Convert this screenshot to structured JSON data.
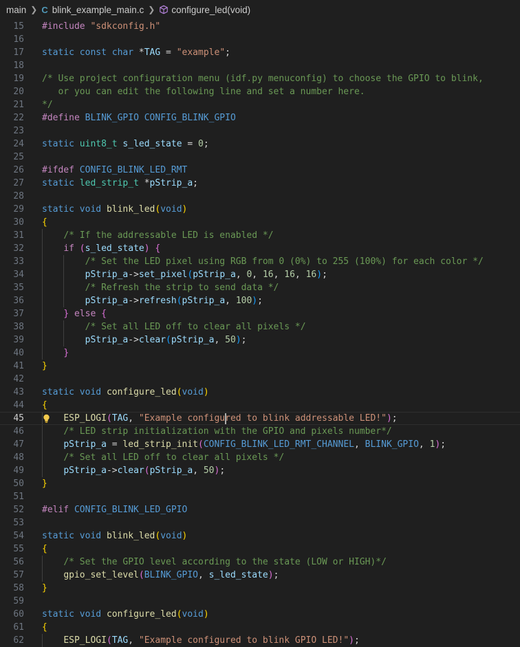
{
  "breadcrumb": {
    "folder": "main",
    "file_icon_letter": "C",
    "file": "blink_example_main.c",
    "symbol": "configure_led(void)"
  },
  "editor": {
    "current_line": 45,
    "lines": [
      {
        "n": "15",
        "t": [
          [
            "pp",
            "#include "
          ],
          [
            "str",
            "\"sdkconfig.h\""
          ]
        ]
      },
      {
        "n": "16",
        "t": []
      },
      {
        "n": "17",
        "t": [
          [
            "kw",
            "static "
          ],
          [
            "kw",
            "const "
          ],
          [
            "kw",
            "char "
          ],
          [
            "pl",
            "*"
          ],
          [
            "var",
            "TAG"
          ],
          [
            "pl",
            " = "
          ],
          [
            "str",
            "\"example\""
          ],
          [
            "pl",
            ";"
          ]
        ]
      },
      {
        "n": "18",
        "t": []
      },
      {
        "n": "19",
        "t": [
          [
            "cmt",
            "/* Use project configuration menu (idf.py menuconfig) to choose the GPIO to blink,"
          ]
        ]
      },
      {
        "n": "20",
        "t": [
          [
            "cmt",
            "   or you can edit the following line and set a number here."
          ]
        ]
      },
      {
        "n": "21",
        "t": [
          [
            "cmt",
            "*/"
          ]
        ]
      },
      {
        "n": "22",
        "t": [
          [
            "pp",
            "#define "
          ],
          [
            "mac",
            "BLINK_GPIO "
          ],
          [
            "mac",
            "CONFIG_BLINK_GPIO"
          ]
        ]
      },
      {
        "n": "23",
        "t": []
      },
      {
        "n": "24",
        "t": [
          [
            "kw",
            "static "
          ],
          [
            "ty",
            "uint8_t "
          ],
          [
            "var",
            "s_led_state"
          ],
          [
            "pl",
            " = "
          ],
          [
            "num",
            "0"
          ],
          [
            "pl",
            ";"
          ]
        ]
      },
      {
        "n": "25",
        "t": []
      },
      {
        "n": "26",
        "t": [
          [
            "pp",
            "#ifdef "
          ],
          [
            "mac",
            "CONFIG_BLINK_LED_RMT"
          ]
        ]
      },
      {
        "n": "27",
        "t": [
          [
            "kw",
            "static "
          ],
          [
            "ty",
            "led_strip_t "
          ],
          [
            "pl",
            "*"
          ],
          [
            "var",
            "pStrip_a"
          ],
          [
            "pl",
            ";"
          ]
        ]
      },
      {
        "n": "28",
        "t": []
      },
      {
        "n": "29",
        "t": [
          [
            "kw",
            "static "
          ],
          [
            "kw",
            "void "
          ],
          [
            "fn",
            "blink_led"
          ],
          [
            "br1",
            "("
          ],
          [
            "kw",
            "void"
          ],
          [
            "br1",
            ")"
          ]
        ]
      },
      {
        "n": "30",
        "t": [
          [
            "br1",
            "{"
          ]
        ]
      },
      {
        "n": "31",
        "t": [
          [
            "pl",
            "    "
          ],
          [
            "cmt",
            "/* If the addressable LED is enabled */"
          ]
        ]
      },
      {
        "n": "32",
        "t": [
          [
            "pl",
            "    "
          ],
          [
            "pp",
            "if "
          ],
          [
            "br2",
            "("
          ],
          [
            "var",
            "s_led_state"
          ],
          [
            "br2",
            ")"
          ],
          [
            "pl",
            " "
          ],
          [
            "br2",
            "{"
          ]
        ]
      },
      {
        "n": "33",
        "t": [
          [
            "pl",
            "        "
          ],
          [
            "cmt",
            "/* Set the LED pixel using RGB from 0 (0%) to 255 (100%) for each color */"
          ]
        ]
      },
      {
        "n": "34",
        "t": [
          [
            "pl",
            "        "
          ],
          [
            "var",
            "pStrip_a"
          ],
          [
            "pl",
            "->"
          ],
          [
            "var",
            "set_pixel"
          ],
          [
            "br3",
            "("
          ],
          [
            "var",
            "pStrip_a"
          ],
          [
            "pl",
            ", "
          ],
          [
            "num",
            "0"
          ],
          [
            "pl",
            ", "
          ],
          [
            "num",
            "16"
          ],
          [
            "pl",
            ", "
          ],
          [
            "num",
            "16"
          ],
          [
            "pl",
            ", "
          ],
          [
            "num",
            "16"
          ],
          [
            "br3",
            ")"
          ],
          [
            "pl",
            ";"
          ]
        ]
      },
      {
        "n": "35",
        "t": [
          [
            "pl",
            "        "
          ],
          [
            "cmt",
            "/* Refresh the strip to send data */"
          ]
        ]
      },
      {
        "n": "36",
        "t": [
          [
            "pl",
            "        "
          ],
          [
            "var",
            "pStrip_a"
          ],
          [
            "pl",
            "->"
          ],
          [
            "var",
            "refresh"
          ],
          [
            "br3",
            "("
          ],
          [
            "var",
            "pStrip_a"
          ],
          [
            "pl",
            ", "
          ],
          [
            "num",
            "100"
          ],
          [
            "br3",
            ")"
          ],
          [
            "pl",
            ";"
          ]
        ]
      },
      {
        "n": "37",
        "t": [
          [
            "pl",
            "    "
          ],
          [
            "br2",
            "}"
          ],
          [
            "pl",
            " "
          ],
          [
            "pp",
            "else "
          ],
          [
            "br2",
            "{"
          ]
        ]
      },
      {
        "n": "38",
        "t": [
          [
            "pl",
            "        "
          ],
          [
            "cmt",
            "/* Set all LED off to clear all pixels */"
          ]
        ]
      },
      {
        "n": "39",
        "t": [
          [
            "pl",
            "        "
          ],
          [
            "var",
            "pStrip_a"
          ],
          [
            "pl",
            "->"
          ],
          [
            "var",
            "clear"
          ],
          [
            "br3",
            "("
          ],
          [
            "var",
            "pStrip_a"
          ],
          [
            "pl",
            ", "
          ],
          [
            "num",
            "50"
          ],
          [
            "br3",
            ")"
          ],
          [
            "pl",
            ";"
          ]
        ]
      },
      {
        "n": "40",
        "t": [
          [
            "pl",
            "    "
          ],
          [
            "br2",
            "}"
          ]
        ]
      },
      {
        "n": "41",
        "t": [
          [
            "br1",
            "}"
          ]
        ]
      },
      {
        "n": "42",
        "t": []
      },
      {
        "n": "43",
        "t": [
          [
            "kw",
            "static "
          ],
          [
            "kw",
            "void "
          ],
          [
            "fn",
            "configure_led"
          ],
          [
            "br1",
            "("
          ],
          [
            "kw",
            "void"
          ],
          [
            "br1",
            ")"
          ]
        ]
      },
      {
        "n": "44",
        "t": [
          [
            "br1",
            "{"
          ]
        ]
      },
      {
        "n": "45",
        "t": [
          [
            "pl",
            "    "
          ],
          [
            "fn",
            "ESP_LOGI"
          ],
          [
            "br2",
            "("
          ],
          [
            "var",
            "TAG"
          ],
          [
            "pl",
            ", "
          ],
          [
            "str",
            "\"Example configured to blink addressable LED!\""
          ],
          [
            "br2",
            ")"
          ],
          [
            "pl",
            ";"
          ]
        ]
      },
      {
        "n": "46",
        "t": [
          [
            "pl",
            "    "
          ],
          [
            "cmt",
            "/* LED strip initialization with the GPIO and pixels number*/"
          ]
        ]
      },
      {
        "n": "47",
        "t": [
          [
            "pl",
            "    "
          ],
          [
            "var",
            "pStrip_a"
          ],
          [
            "pl",
            " = "
          ],
          [
            "fn",
            "led_strip_init"
          ],
          [
            "br2",
            "("
          ],
          [
            "mac",
            "CONFIG_BLINK_LED_RMT_CHANNEL"
          ],
          [
            "pl",
            ", "
          ],
          [
            "mac",
            "BLINK_GPIO"
          ],
          [
            "pl",
            ", "
          ],
          [
            "num",
            "1"
          ],
          [
            "br2",
            ")"
          ],
          [
            "pl",
            ";"
          ]
        ]
      },
      {
        "n": "48",
        "t": [
          [
            "pl",
            "    "
          ],
          [
            "cmt",
            "/* Set all LED off to clear all pixels */"
          ]
        ]
      },
      {
        "n": "49",
        "t": [
          [
            "pl",
            "    "
          ],
          [
            "var",
            "pStrip_a"
          ],
          [
            "pl",
            "->"
          ],
          [
            "var",
            "clear"
          ],
          [
            "br2",
            "("
          ],
          [
            "var",
            "pStrip_a"
          ],
          [
            "pl",
            ", "
          ],
          [
            "num",
            "50"
          ],
          [
            "br2",
            ")"
          ],
          [
            "pl",
            ";"
          ]
        ]
      },
      {
        "n": "50",
        "t": [
          [
            "br1",
            "}"
          ]
        ]
      },
      {
        "n": "51",
        "t": []
      },
      {
        "n": "52",
        "t": [
          [
            "pp",
            "#elif "
          ],
          [
            "mac",
            "CONFIG_BLINK_LED_GPIO"
          ]
        ]
      },
      {
        "n": "53",
        "t": []
      },
      {
        "n": "54",
        "t": [
          [
            "kw",
            "static "
          ],
          [
            "kw",
            "void "
          ],
          [
            "fn",
            "blink_led"
          ],
          [
            "br1",
            "("
          ],
          [
            "kw",
            "void"
          ],
          [
            "br1",
            ")"
          ]
        ]
      },
      {
        "n": "55",
        "t": [
          [
            "br1",
            "{"
          ]
        ]
      },
      {
        "n": "56",
        "t": [
          [
            "pl",
            "    "
          ],
          [
            "cmt",
            "/* Set the GPIO level according to the state (LOW or HIGH)*/"
          ]
        ]
      },
      {
        "n": "57",
        "t": [
          [
            "pl",
            "    "
          ],
          [
            "fn",
            "gpio_set_level"
          ],
          [
            "br2",
            "("
          ],
          [
            "mac",
            "BLINK_GPIO"
          ],
          [
            "pl",
            ", "
          ],
          [
            "var",
            "s_led_state"
          ],
          [
            "br2",
            ")"
          ],
          [
            "pl",
            ";"
          ]
        ]
      },
      {
        "n": "58",
        "t": [
          [
            "br1",
            "}"
          ]
        ]
      },
      {
        "n": "59",
        "t": []
      },
      {
        "n": "60",
        "t": [
          [
            "kw",
            "static "
          ],
          [
            "kw",
            "void "
          ],
          [
            "fn",
            "configure_led"
          ],
          [
            "br1",
            "("
          ],
          [
            "kw",
            "void"
          ],
          [
            "br1",
            ")"
          ]
        ]
      },
      {
        "n": "61",
        "t": [
          [
            "br1",
            "{"
          ]
        ]
      },
      {
        "n": "62",
        "t": [
          [
            "pl",
            "    "
          ],
          [
            "fn",
            "ESP_LOGI"
          ],
          [
            "br2",
            "("
          ],
          [
            "var",
            "TAG"
          ],
          [
            "pl",
            ", "
          ],
          [
            "str",
            "\"Example configured to blink GPIO LED!\""
          ],
          [
            "br2",
            ")"
          ],
          [
            "pl",
            ";"
          ]
        ]
      }
    ]
  },
  "colors": {
    "background": "#1f1f1f",
    "keyword": "#569cd6",
    "string": "#ce9178",
    "comment": "#6a9955",
    "preprocessor": "#c586c0",
    "function": "#dcdcaa",
    "variable": "#9cdcfe",
    "type": "#4ec9b0",
    "number": "#b5cea8",
    "lightbulb": "#f2c94c"
  }
}
